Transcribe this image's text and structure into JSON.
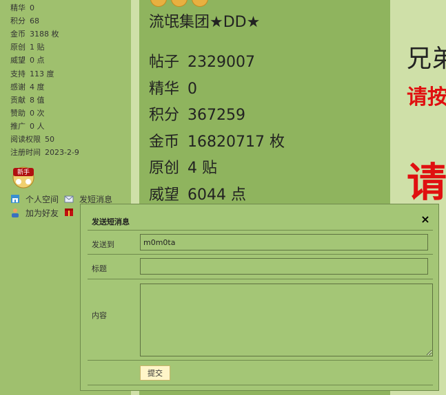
{
  "left_stats": [
    {
      "label": "精华",
      "value": "0"
    },
    {
      "label": "积分",
      "value": "68"
    },
    {
      "label": "金币",
      "value": "3188 枚"
    },
    {
      "label": "原创",
      "value": "1 贴"
    },
    {
      "label": "威望",
      "value": "0 点"
    },
    {
      "label": "支持",
      "value": "113 度"
    },
    {
      "label": "感谢",
      "value": "4 度"
    },
    {
      "label": "贡献",
      "value": "8 值"
    },
    {
      "label": "赞助",
      "value": "0 次"
    },
    {
      "label": "推广",
      "value": "0 人"
    },
    {
      "label": "阅读权限",
      "value": "50"
    },
    {
      "label": "注册时间",
      "value": "2023-2-9"
    }
  ],
  "left_badge": "新手",
  "left_links": {
    "space": "个人空间",
    "message": "发短消息",
    "add_friend": "加为好友"
  },
  "middle": {
    "user_title": "流氓集团★DD★",
    "stats": [
      {
        "label": "帖子",
        "value": "2329007"
      },
      {
        "label": "精华",
        "value": "0"
      },
      {
        "label": "积分",
        "value": "367259"
      },
      {
        "label": "金币",
        "value": "16820717 枚"
      },
      {
        "label": "原创",
        "value": "4 贴"
      },
      {
        "label": "威望",
        "value": "6044 点"
      }
    ]
  },
  "right": {
    "big1": "兄弟",
    "red1": "请按",
    "red2": "请"
  },
  "dialog": {
    "title": "发送短消息",
    "close_symbol": "×",
    "to_label": "发送到",
    "to_value": "m0m0ta",
    "subject_label": "标题",
    "subject_value": "",
    "content_label": "内容",
    "content_value": "",
    "submit_label": "提交"
  }
}
